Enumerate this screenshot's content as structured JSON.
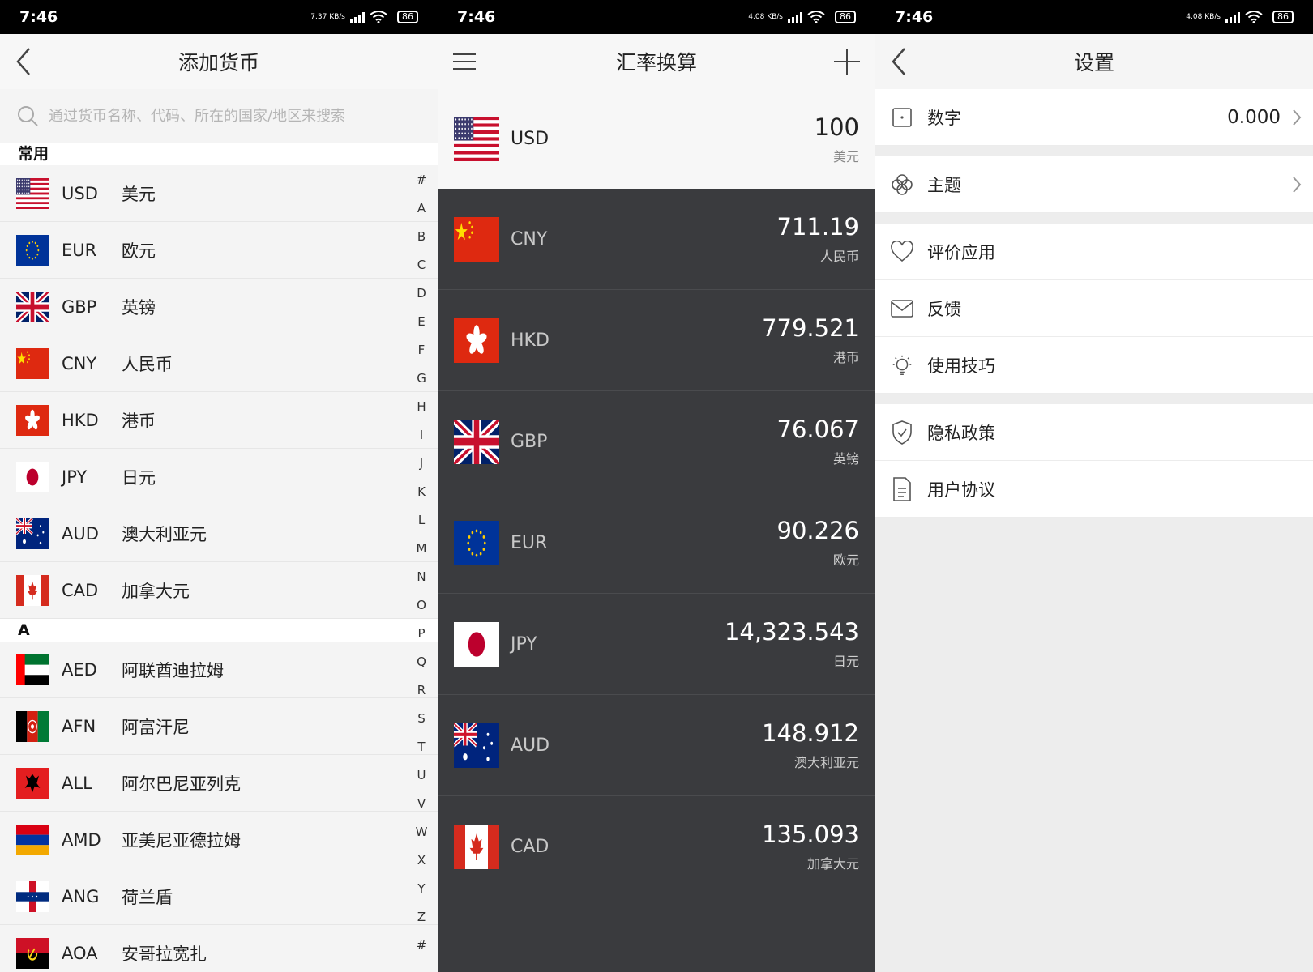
{
  "status": {
    "screen1": {
      "time": "7:46",
      "speed": "7.37 KB/s",
      "battery": "86"
    },
    "screen2": {
      "time": "7:46",
      "speed": "4.08 KB/s",
      "battery": "86"
    },
    "screen3": {
      "time": "7:46",
      "speed": "4.08 KB/s",
      "battery": "86"
    }
  },
  "add_currency": {
    "title": "添加货币",
    "search_placeholder": "通过货币名称、代码、所在的国家/地区来搜索",
    "common_header": "常用",
    "common": [
      {
        "code": "USD",
        "name": "美元",
        "flag": "us"
      },
      {
        "code": "EUR",
        "name": "欧元",
        "flag": "eu"
      },
      {
        "code": "GBP",
        "name": "英镑",
        "flag": "gb"
      },
      {
        "code": "CNY",
        "name": "人民币",
        "flag": "cn"
      },
      {
        "code": "HKD",
        "name": "港币",
        "flag": "hk"
      },
      {
        "code": "JPY",
        "name": "日元",
        "flag": "jp"
      },
      {
        "code": "AUD",
        "name": "澳大利亚元",
        "flag": "au"
      },
      {
        "code": "CAD",
        "name": "加拿大元",
        "flag": "ca"
      }
    ],
    "a_header": "A",
    "a_list": [
      {
        "code": "AED",
        "name": "阿联酋迪拉姆",
        "flag": "ae"
      },
      {
        "code": "AFN",
        "name": "阿富汗尼",
        "flag": "af"
      },
      {
        "code": "ALL",
        "name": "阿尔巴尼亚列克",
        "flag": "al"
      },
      {
        "code": "AMD",
        "name": "亚美尼亚德拉姆",
        "flag": "am"
      },
      {
        "code": "ANG",
        "name": "荷兰盾",
        "flag": "an"
      },
      {
        "code": "AOA",
        "name": "安哥拉宽扎",
        "flag": "ao"
      }
    ],
    "index_letters": [
      "#",
      "A",
      "B",
      "C",
      "D",
      "E",
      "F",
      "G",
      "H",
      "I",
      "J",
      "K",
      "L",
      "M",
      "N",
      "O",
      "P",
      "Q",
      "R",
      "S",
      "T",
      "U",
      "V",
      "W",
      "X",
      "Y",
      "Z",
      "#"
    ]
  },
  "converter": {
    "title": "汇率换算",
    "base": {
      "code": "USD",
      "value": "100",
      "name": "美元",
      "flag": "us"
    },
    "rows": [
      {
        "code": "CNY",
        "value": "711.19",
        "name": "人民币",
        "flag": "cn"
      },
      {
        "code": "HKD",
        "value": "779.521",
        "name": "港币",
        "flag": "hk"
      },
      {
        "code": "GBP",
        "value": "76.067",
        "name": "英镑",
        "flag": "gb"
      },
      {
        "code": "EUR",
        "value": "90.226",
        "name": "欧元",
        "flag": "eu"
      },
      {
        "code": "JPY",
        "value": "14,323.543",
        "name": "日元",
        "flag": "jp"
      },
      {
        "code": "AUD",
        "value": "148.912",
        "name": "澳大利亚元",
        "flag": "au"
      },
      {
        "code": "CAD",
        "value": "135.093",
        "name": "加拿大元",
        "flag": "ca"
      }
    ]
  },
  "settings": {
    "title": "设置",
    "digits": {
      "label": "数字",
      "value": "0.000",
      "icon": "digits-icon"
    },
    "theme": {
      "label": "主题",
      "icon": "theme-icon"
    },
    "rate": {
      "label": "评价应用",
      "icon": "heart-icon"
    },
    "feedback": {
      "label": "反馈",
      "icon": "mail-icon"
    },
    "tips": {
      "label": "使用技巧",
      "icon": "bulb-icon"
    },
    "privacy": {
      "label": "隐私政策",
      "icon": "shield-icon"
    },
    "agreement": {
      "label": "用户协议",
      "icon": "document-icon"
    }
  }
}
